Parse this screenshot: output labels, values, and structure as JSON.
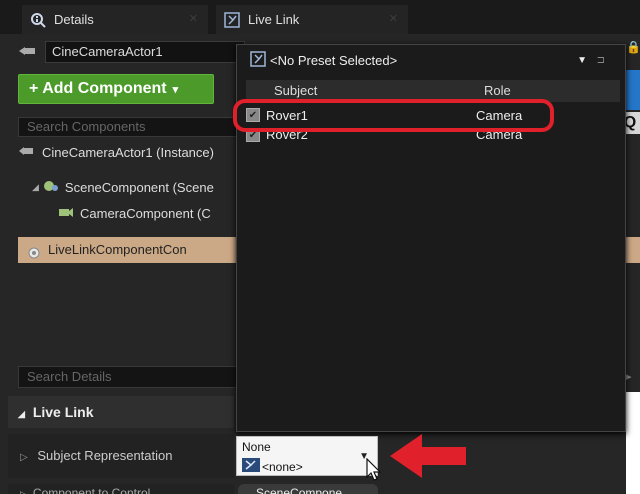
{
  "tabs": [
    {
      "label": "Details",
      "icon": "magnifier-info-icon"
    },
    {
      "label": "Live Link",
      "icon": "livelink-icon"
    }
  ],
  "actor": {
    "name": "CineCameraActor1"
  },
  "add_component_label": "+ Add Component",
  "search_components_placeholder": "Search Components",
  "tree": [
    {
      "label": "CineCameraActor1 (Instance)"
    },
    {
      "label": "SceneComponent (Scene"
    },
    {
      "label": "CameraComponent (C"
    },
    {
      "label": "LiveLinkComponentCon"
    }
  ],
  "search_details_placeholder": "Search Details",
  "category": "Live Link",
  "property": {
    "label": "Subject Representation"
  },
  "dropdown": {
    "title": "None",
    "value": "<none>"
  },
  "next_row_label": "Component to Control",
  "next_row_value": "SceneCompone",
  "popup": {
    "preset": "<No Preset Selected>",
    "columns": {
      "subject": "Subject",
      "role": "Role"
    },
    "rows": [
      {
        "subject": "Rover1",
        "role": "Camera",
        "checked": true
      },
      {
        "subject": "Rover2",
        "role": "Camera",
        "checked": true
      }
    ]
  },
  "colors": {
    "highlight": "#e0202a",
    "add_button": "#4b9a2a",
    "selected_row": "#cba986"
  }
}
